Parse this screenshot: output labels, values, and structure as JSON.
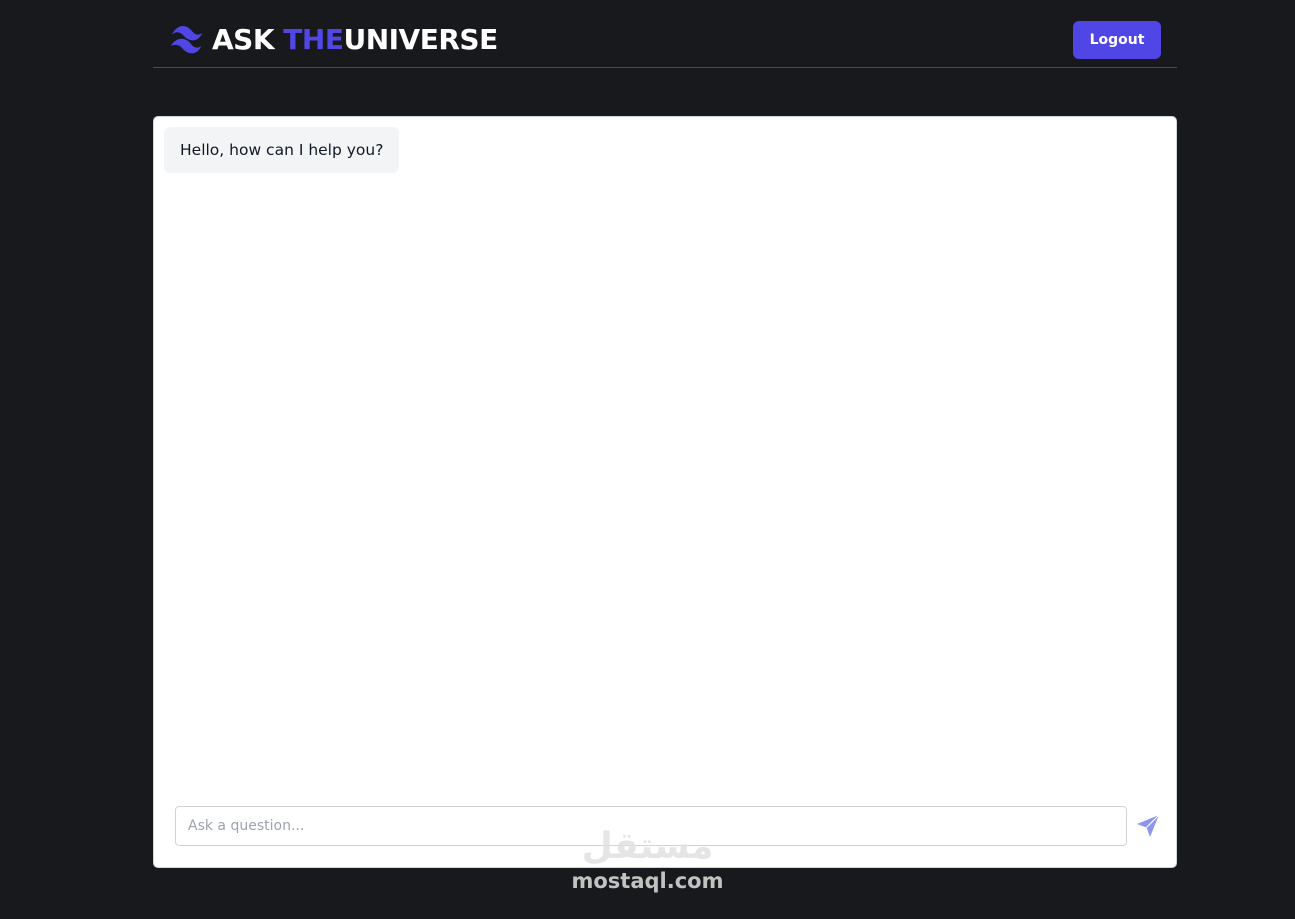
{
  "header": {
    "brand": {
      "part1": "ASK ",
      "part2": "THE",
      "part3": "UNIVERSE"
    },
    "logout_label": "Logout"
  },
  "chat": {
    "messages": [
      {
        "text": "Hello, how can I help you?"
      }
    ],
    "input_placeholder": "Ask a question...",
    "input_value": ""
  },
  "watermark": {
    "arabic": "مستقل",
    "latin": "mostaql.com"
  },
  "colors": {
    "background": "#18191d",
    "accent": "#5046e5",
    "send_icon": "#8c96ea",
    "bubble_bg": "#f3f4f6"
  },
  "icons": {
    "brand": "wave-logo-icon",
    "send": "send-arrow-icon"
  }
}
